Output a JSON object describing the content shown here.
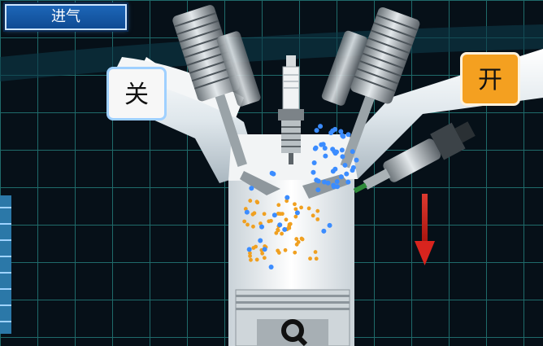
{
  "stage_label": "进气",
  "left_valve_tag": "关",
  "right_valve_tag": "开",
  "colors": {
    "stage_bg": "#1d66b8",
    "closed_tag_bg": "#f7f7f7",
    "open_tag_bg": "#f4a020",
    "arrow": "#d8241e",
    "air_particles": "#3b8cff",
    "fuel_particles": "#f0a020"
  },
  "icons": [
    "spark-plug-icon",
    "fuel-injector-icon",
    "down-arrow-icon",
    "piston-icon"
  ]
}
